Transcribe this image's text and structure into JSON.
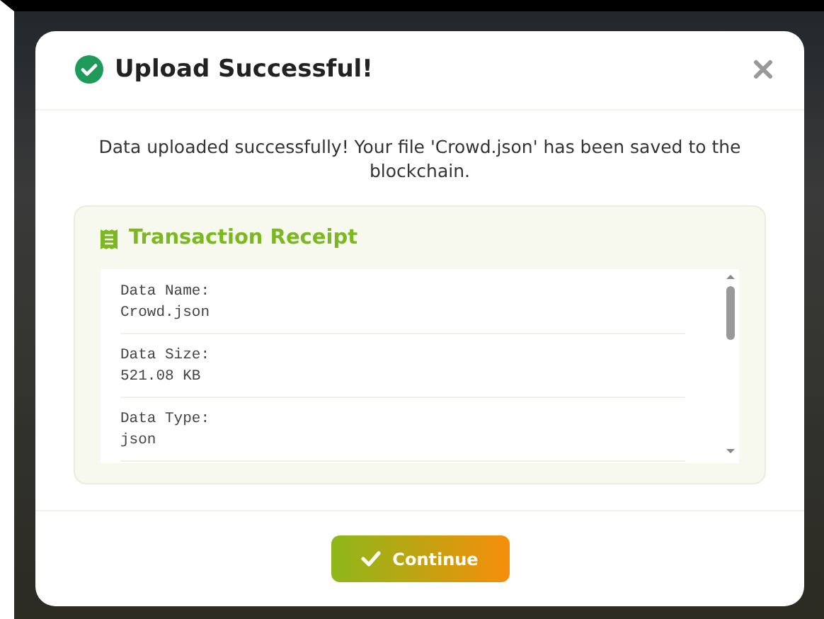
{
  "dialog": {
    "title": "Upload Successful!",
    "message": "Data uploaded successfully! Your file 'Crowd.json' has been saved to the blockchain.",
    "receipt": {
      "title": "Transaction Receipt",
      "fields": [
        {
          "label": "Data Name:",
          "value": "Crowd.json"
        },
        {
          "label": "Data Size:",
          "value": "521.08 KB"
        },
        {
          "label": "Data Type:",
          "value": "json"
        }
      ]
    },
    "buttons": [
      {
        "label": "Continue"
      }
    ]
  }
}
